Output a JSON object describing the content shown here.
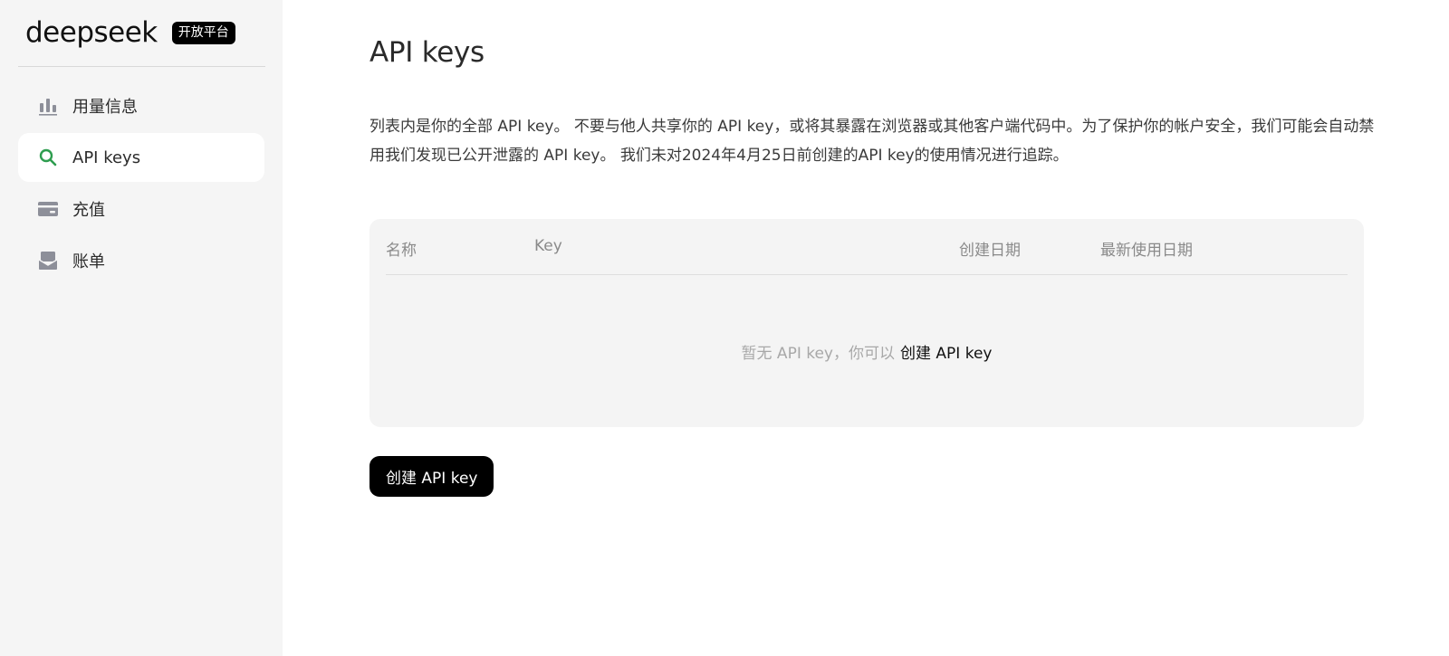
{
  "brand": {
    "logo": "deepseek",
    "badge": "开放平台"
  },
  "sidebar": {
    "items": [
      {
        "label": "用量信息",
        "icon": "bar-chart-icon",
        "active": false
      },
      {
        "label": "API keys",
        "icon": "search-key-icon",
        "active": true
      },
      {
        "label": "充值",
        "icon": "card-icon",
        "active": false
      },
      {
        "label": "账单",
        "icon": "bill-icon",
        "active": false
      }
    ]
  },
  "main": {
    "title": "API keys",
    "description": "列表内是你的全部 API key。 不要与他人共享你的 API key，或将其暴露在浏览器或其他客户端代码中。为了保护你的帐户安全，我们可能会自动禁用我们发现已公开泄露的 API key。 我们未对2024年4月25日前创建的API key的使用情况进行追踪。",
    "table": {
      "headers": {
        "name": "名称",
        "key": "Key",
        "created": "创建日期",
        "last_used": "最新使用日期"
      },
      "empty_text": "暂无 API key，你可以",
      "empty_link": "创建 API key"
    },
    "create_button": "创建 API key"
  },
  "colors": {
    "sidebar_bg": "#f5f5f5",
    "accent_green": "#2e9d4f",
    "icon_gray": "#8d8f99",
    "button_bg": "#000000"
  }
}
